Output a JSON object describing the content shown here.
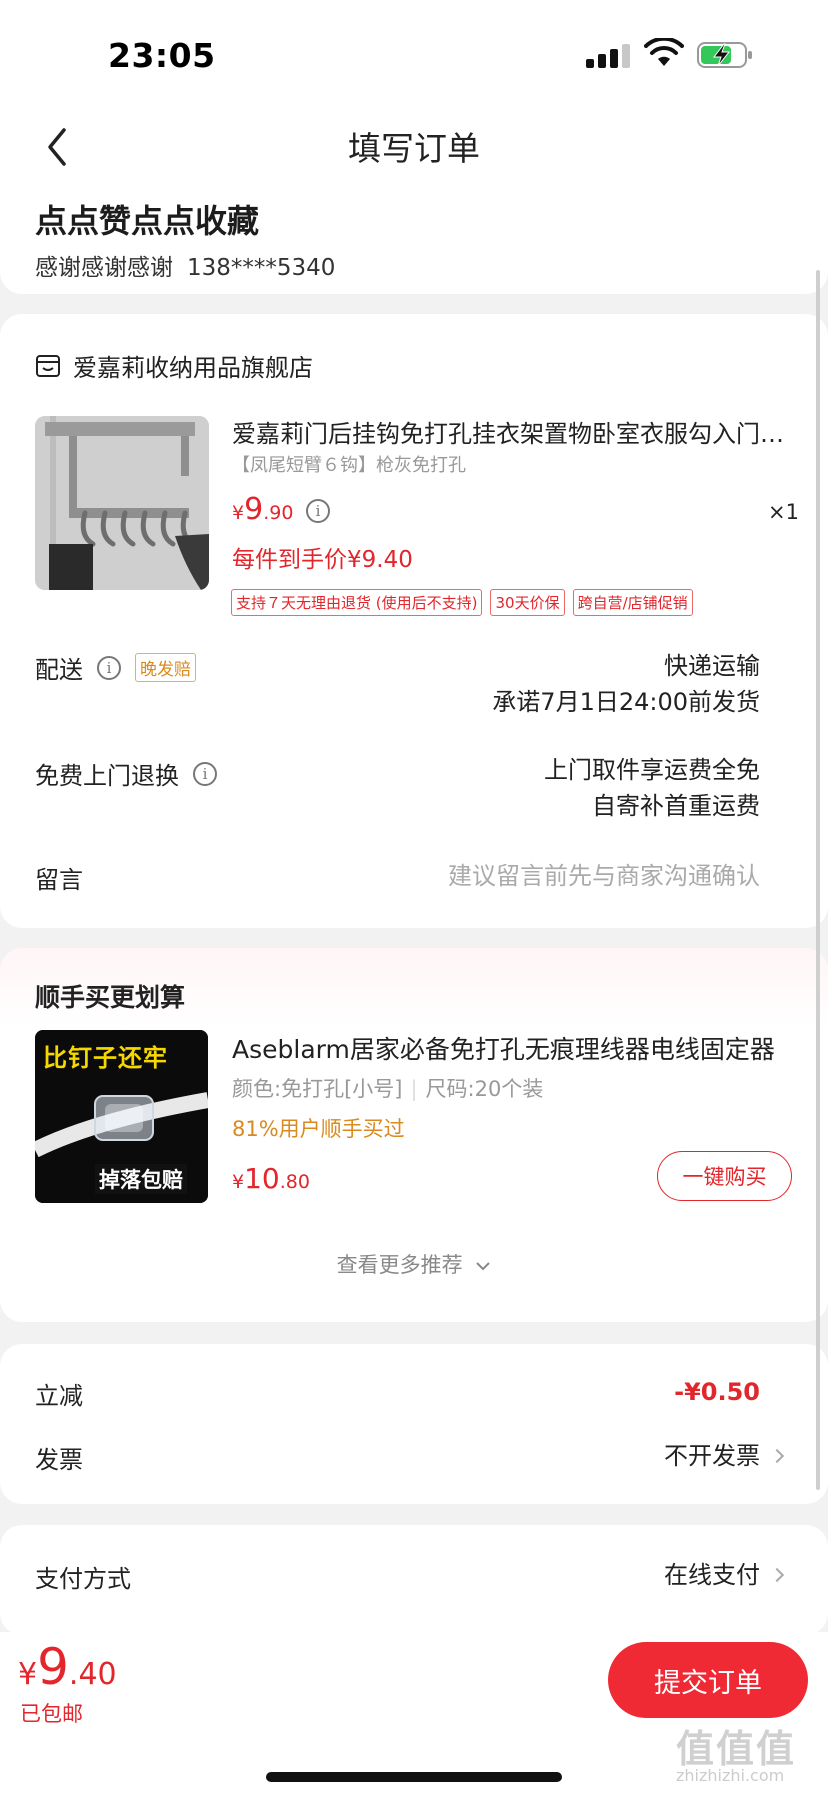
{
  "status": {
    "time": "23:05"
  },
  "nav": {
    "title": "填写订单"
  },
  "address": {
    "name": "点点赞点点收藏",
    "recipient": "感谢感谢感谢",
    "phone": "138****5340"
  },
  "store": {
    "name": "爱嘉莉收纳用品旗舰店"
  },
  "product": {
    "title": "爱嘉莉门后挂钩免打孔挂衣架置物卧室衣服勾入门挂钩",
    "spec": "【凤尾短臂６钩】枪灰免打孔",
    "price_symbol": "¥",
    "price_int": "9",
    "price_dec": ".90",
    "qty": "×1",
    "final_price": "每件到手价¥9.40",
    "tags": [
      "支持７天无理由退货 (使用后不支持)",
      "30天价保",
      "跨自营/店铺促销"
    ]
  },
  "delivery": {
    "label": "配送",
    "badge": "晚发赔",
    "method": "快递运输",
    "promise": "承诺7月1日24:00前发货"
  },
  "returns": {
    "label": "免费上门退换",
    "line1": "上门取件享运费全免",
    "line2": "自寄补首重运费"
  },
  "message": {
    "label": "留言",
    "placeholder": "建议留言前先与商家沟通确认"
  },
  "recommend": {
    "title": "顺手买更划算",
    "img_text_top": "比钉子还牢",
    "img_text_bottom": "掉落包赔",
    "name": "Aseblarm居家必备免打孔无痕理线器电线固定器",
    "spec_color": "颜色:免打孔[小号]",
    "spec_size": "尺码:20个装",
    "bought": "81%用户顺手买过",
    "price_symbol": "¥",
    "price_int": "10",
    "price_dec": ".80",
    "buy_label": "一键购买",
    "more_label": "查看更多推荐"
  },
  "discount": {
    "label": "立减",
    "value": "-¥0.50"
  },
  "invoice": {
    "label": "发票",
    "value": "不开发票"
  },
  "payment": {
    "label": "支付方式",
    "value": "在线支付"
  },
  "footer": {
    "total_symbol": "¥",
    "total_int": "9",
    "total_dec": ".40",
    "shipping": "已包邮",
    "submit_label": "提交订单"
  },
  "watermark": {
    "main": "值值值",
    "sub": "zhizhizhi.com"
  },
  "colors": {
    "accent": "#e2262b",
    "submit_bg": "#f02a35",
    "warning": "#d98a1f"
  }
}
